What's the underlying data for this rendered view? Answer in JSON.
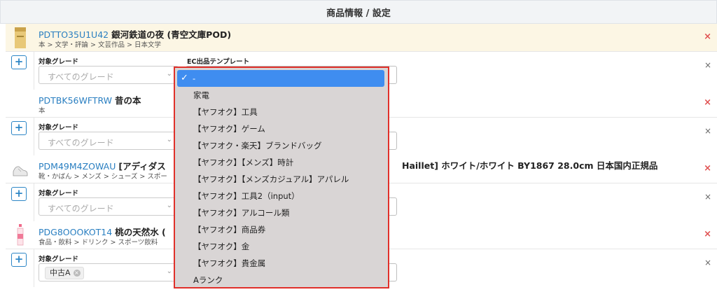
{
  "header": {
    "title": "商品情報 / 設定"
  },
  "labels": {
    "grade": "対象グレード",
    "ec_template": "EC出品テンプレート",
    "add": "+",
    "remove": "×",
    "row_remove": "×",
    "chev": "⌄"
  },
  "products": [
    {
      "code": "PDTTO35U1U42",
      "name": "銀河鉄道の夜 (青空文庫POD)",
      "category": "本 > 文学・評論 > 文芸作品 > 日本文学",
      "grade_placeholder": "すべてのグレード",
      "grade_chip": "",
      "highlight": true
    },
    {
      "code": "PDTBK56WFTRW",
      "name": "昔の本",
      "category": "本",
      "grade_placeholder": "すべてのグレード",
      "grade_chip": "",
      "highlight": false
    },
    {
      "code": "PDM49M4ZOWAU",
      "name": "[アディダス",
      "category": "靴・かばん > メンズ > シューズ > スポー",
      "name_tail": "Haillet] ホワイト/ホワイト BY1867 28.0cm 日本国内正規品",
      "grade_placeholder": "すべてのグレード",
      "grade_chip": "",
      "highlight": false
    },
    {
      "code": "PDG8OOOKOT14",
      "name": "桃の天然水 (",
      "category": "食品・飲料 > ドリンク > スポーツ飲料",
      "grade_placeholder": "",
      "grade_chip": "中古A",
      "highlight": false
    }
  ],
  "dropdown": {
    "selected": "-",
    "options": [
      "-",
      "家電",
      "【ヤフオク】工具",
      "【ヤフオク】ゲーム",
      "【ヤフオク・楽天】ブランドバッグ",
      "【ヤフオク】【メンズ】時計",
      "【ヤフオク】【メンズカジュアル】アパレル",
      "【ヤフオク】工具2（input）",
      "【ヤフオク】アルコール類",
      "【ヤフオク】商品券",
      "【ヤフオク】金",
      "【ヤフオク】貴金属",
      "Aランク"
    ]
  },
  "colors": {
    "accent": "#3f8df0",
    "highlight_border": "#e0302a",
    "link": "#2a7fc1",
    "remove": "#e05050"
  }
}
